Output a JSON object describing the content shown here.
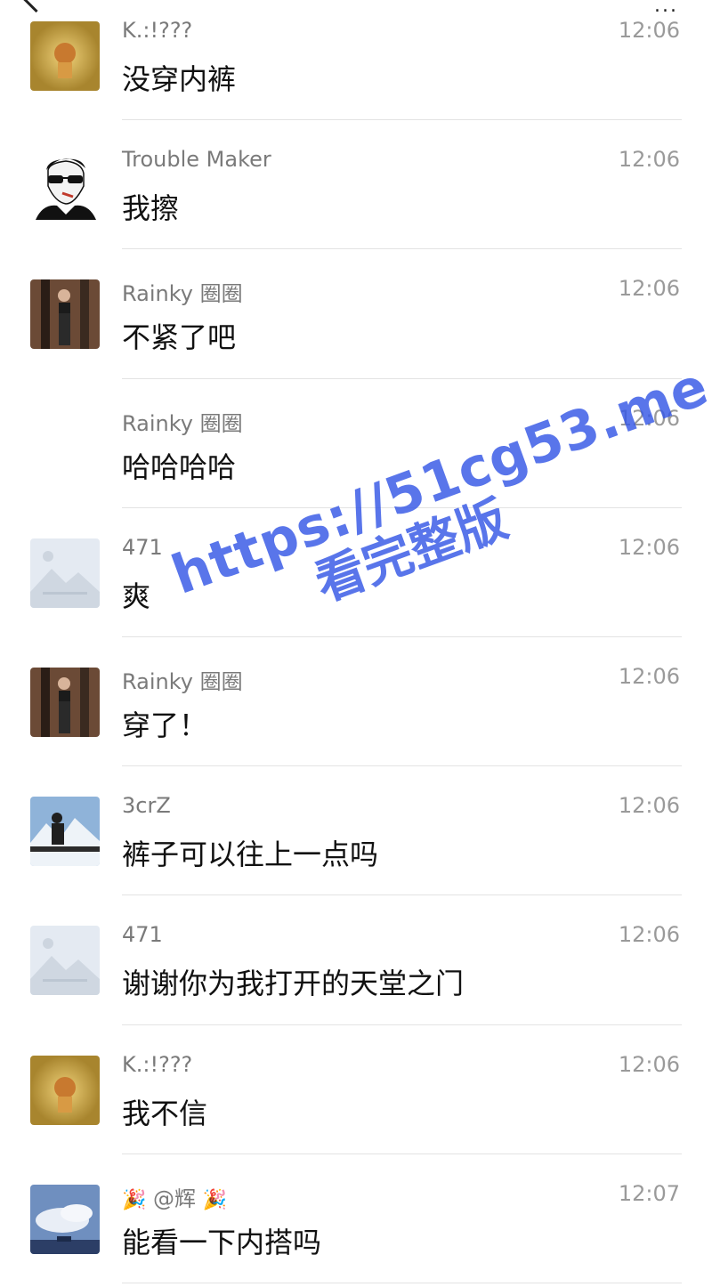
{
  "header": {
    "more_icon": "..."
  },
  "messages": [
    {
      "sender": "K.:!???",
      "time": "12:06",
      "text": "没穿内裤",
      "avatar": "golden-artwork-avatar"
    },
    {
      "sender": "Trouble Maker",
      "time": "12:06",
      "text": "我擦",
      "avatar": "sunglasses-cartoon-avatar"
    },
    {
      "sender": "Rainky 圈圈",
      "time": "12:06",
      "text": "不紧了吧",
      "avatar": "mirror-selfie-avatar"
    },
    {
      "sender": "Rainky 圈圈",
      "time": "12:06",
      "text": "哈哈哈哈",
      "avatar": null
    },
    {
      "sender": "471",
      "time": "12:06",
      "text": "爽",
      "avatar": "placeholder-image-avatar"
    },
    {
      "sender": "Rainky 圈圈",
      "time": "12:06",
      "text": "穿了！",
      "avatar": "mirror-selfie-avatar"
    },
    {
      "sender": "3crZ",
      "time": "12:06",
      "text": "裤子可以往上一点吗",
      "avatar": "snow-mountain-person-avatar"
    },
    {
      "sender": "471",
      "time": "12:06",
      "text": "谢谢你为我打开的天堂之门",
      "avatar": "placeholder-image-avatar"
    },
    {
      "sender": "K.:!???",
      "time": "12:06",
      "text": "我不信",
      "avatar": "golden-artwork-avatar"
    },
    {
      "sender": "@辉",
      "time": "12:07",
      "text": "能看一下内搭吗",
      "avatar": "cloudy-sky-avatar",
      "decor": "🎉"
    }
  ],
  "watermark": {
    "url": "https://51cg53.me",
    "subtitle": "看完整版"
  },
  "colors": {
    "sender": "#7a7a7a",
    "time": "#9a9a9a",
    "message": "#111111",
    "divider": "#e3e3e3",
    "watermark": "#3557e6"
  }
}
